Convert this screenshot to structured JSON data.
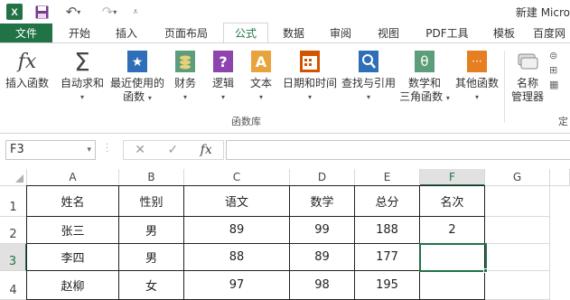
{
  "title": "新建 Micro",
  "tabs": [
    "文件",
    "开始",
    "插入",
    "页面布局",
    "公式",
    "数据",
    "审阅",
    "视图",
    "PDF工具",
    "模板",
    "百度网"
  ],
  "ribbon": {
    "insert_function": "插入函数",
    "autosum": "自动求和",
    "recent_1": "最近使用的",
    "recent_2": "函数",
    "financial": "财务",
    "logical": "逻辑",
    "text": "文本",
    "datetime": "日期和时间",
    "lookup": "查找与引用",
    "math_1": "数学和",
    "math_2": "三角函数",
    "other": "其他函数",
    "name_mgr_1": "名称",
    "name_mgr_2": "管理器",
    "group_library": "函数库",
    "group_defined": "定"
  },
  "formula_bar": {
    "name_box": "F3",
    "fx": "fx",
    "cancel": "✕",
    "enter": "✓",
    "formula": ""
  },
  "columns": [
    "A",
    "B",
    "C",
    "D",
    "E",
    "F",
    "G"
  ],
  "rows": [
    "1",
    "2",
    "3",
    "4"
  ],
  "table": [
    [
      "姓名",
      "性别",
      "语文",
      "数学",
      "总分",
      "名次",
      ""
    ],
    [
      "张三",
      "男",
      "89",
      "99",
      "188",
      "2",
      ""
    ],
    [
      "李四",
      "男",
      "88",
      "89",
      "177",
      "",
      ""
    ],
    [
      "赵柳",
      "女",
      "97",
      "98",
      "195",
      "",
      ""
    ]
  ],
  "colors": {
    "accent": "#217346",
    "file_tab": "#217346"
  }
}
